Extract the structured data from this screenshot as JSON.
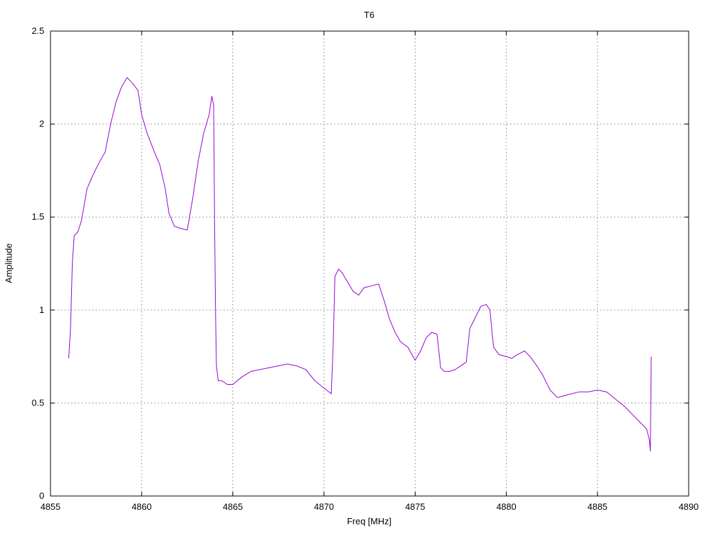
{
  "chart_data": {
    "type": "line",
    "title": "T6",
    "xlabel": "Freq [MHz]",
    "ylabel": "Amplitude",
    "xlim": [
      4855,
      4890
    ],
    "ylim": [
      0,
      2.5
    ],
    "x_ticks": [
      4855,
      4860,
      4865,
      4870,
      4875,
      4880,
      4885,
      4890
    ],
    "y_ticks": [
      0,
      0.5,
      1,
      1.5,
      2,
      2.5
    ],
    "x_tick_labels": [
      "4855",
      "4860",
      "4865",
      "4870",
      "4875",
      "4880",
      "4885",
      "4890"
    ],
    "y_tick_labels": [
      "0",
      "0.5",
      "1",
      "1.5",
      "2",
      "2.5"
    ],
    "grid": true,
    "line_color": "#9400d3",
    "series": [
      {
        "x": [
          4856.0,
          4856.1,
          4856.2,
          4856.3,
          4856.5,
          4856.7,
          4857.0,
          4857.3,
          4857.6,
          4858.0,
          4858.3,
          4858.6,
          4858.9,
          4859.2,
          4859.5,
          4859.8,
          4860.0,
          4860.3,
          4860.7,
          4861.0,
          4861.3,
          4861.5,
          4861.8,
          4862.1,
          4862.5,
          4862.8,
          4863.1,
          4863.4,
          4863.7,
          4863.85,
          4863.95,
          4864.0,
          4864.05,
          4864.1,
          4864.2,
          4864.4,
          4864.7,
          4865.0,
          4865.5,
          4866.0,
          4866.5,
          4867.0,
          4867.5,
          4868.0,
          4868.5,
          4869.0,
          4869.5,
          4870.0,
          4870.4,
          4870.5,
          4870.6,
          4870.8,
          4871.0,
          4871.3,
          4871.6,
          4871.9,
          4872.2,
          4872.6,
          4873.0,
          4873.3,
          4873.6,
          4873.9,
          4874.2,
          4874.6,
          4875.0,
          4875.3,
          4875.6,
          4875.9,
          4876.2,
          4876.4,
          4876.6,
          4876.9,
          4877.2,
          4877.5,
          4877.8,
          4878.0,
          4878.3,
          4878.6,
          4878.9,
          4879.1,
          4879.3,
          4879.6,
          4880.0,
          4880.3,
          4880.6,
          4881.0,
          4881.3,
          4881.6,
          4882.0,
          4882.4,
          4882.8,
          4883.2,
          4883.6,
          4884.0,
          4884.5,
          4885.0,
          4885.5,
          4886.0,
          4886.5,
          4887.0,
          4887.4,
          4887.7,
          4887.85,
          4887.9,
          4887.95
        ],
        "values": [
          0.74,
          0.9,
          1.25,
          1.4,
          1.42,
          1.48,
          1.65,
          1.72,
          1.78,
          1.85,
          2.0,
          2.12,
          2.2,
          2.25,
          2.22,
          2.18,
          2.05,
          1.95,
          1.85,
          1.78,
          1.65,
          1.52,
          1.45,
          1.44,
          1.43,
          1.6,
          1.8,
          1.95,
          2.05,
          2.15,
          2.1,
          1.5,
          1.0,
          0.7,
          0.62,
          0.62,
          0.6,
          0.6,
          0.64,
          0.67,
          0.68,
          0.69,
          0.7,
          0.71,
          0.7,
          0.68,
          0.62,
          0.58,
          0.55,
          0.8,
          1.18,
          1.22,
          1.2,
          1.15,
          1.1,
          1.08,
          1.12,
          1.13,
          1.14,
          1.05,
          0.95,
          0.88,
          0.83,
          0.8,
          0.73,
          0.78,
          0.85,
          0.88,
          0.87,
          0.69,
          0.67,
          0.67,
          0.68,
          0.7,
          0.72,
          0.9,
          0.96,
          1.02,
          1.03,
          1.0,
          0.8,
          0.76,
          0.75,
          0.74,
          0.76,
          0.78,
          0.75,
          0.71,
          0.65,
          0.57,
          0.53,
          0.54,
          0.55,
          0.56,
          0.56,
          0.57,
          0.56,
          0.52,
          0.48,
          0.43,
          0.39,
          0.36,
          0.3,
          0.24,
          0.75
        ]
      }
    ]
  }
}
